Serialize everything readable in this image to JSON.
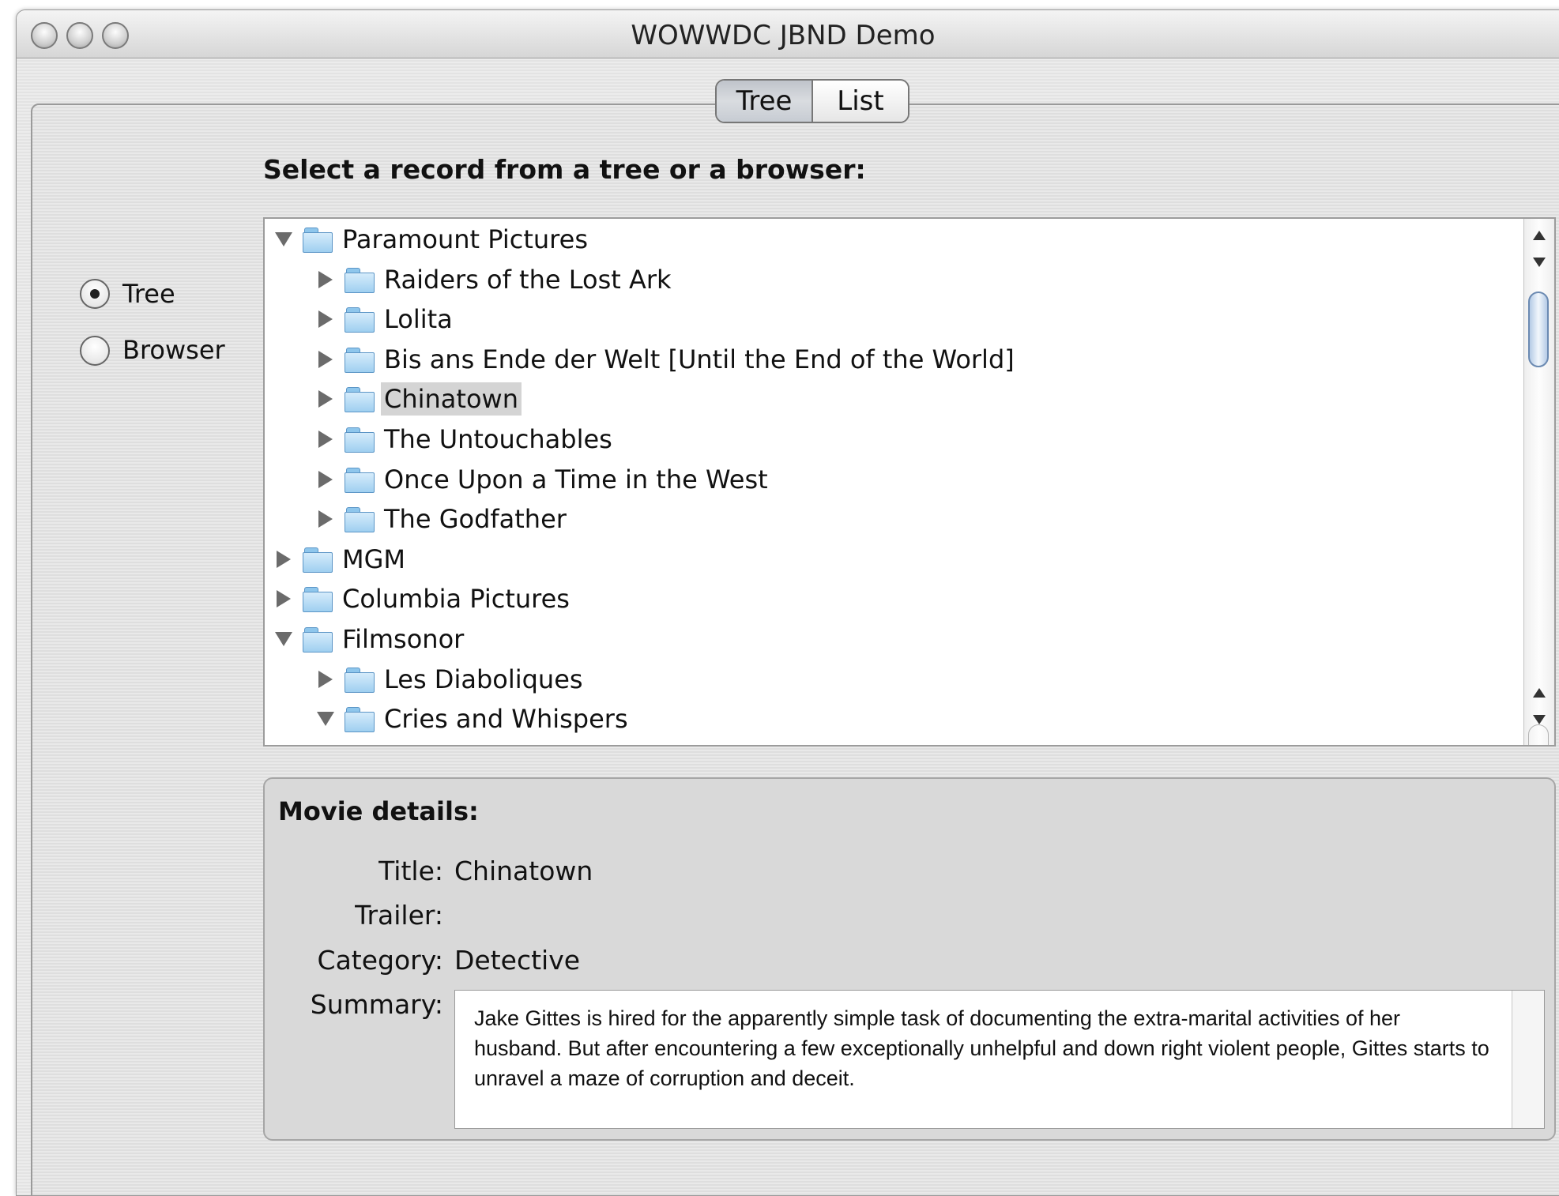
{
  "window": {
    "title": "WOWWDC JBND Demo"
  },
  "tabs": [
    {
      "label": "Tree",
      "selected": true
    },
    {
      "label": "List",
      "selected": false
    }
  ],
  "view_mode": {
    "options": [
      {
        "label": "Tree",
        "selected": true
      },
      {
        "label": "Browser",
        "selected": false
      }
    ]
  },
  "selector": {
    "heading": "Select a record from a tree or a browser:"
  },
  "tree": {
    "rows": [
      {
        "label": "Paramount Pictures",
        "level": 0,
        "expanded": true,
        "selected": false,
        "icon": "folder-icon"
      },
      {
        "label": "Raiders of the Lost Ark",
        "level": 1,
        "expanded": false,
        "selected": false,
        "icon": "folder-icon"
      },
      {
        "label": "Lolita",
        "level": 1,
        "expanded": false,
        "selected": false,
        "icon": "folder-icon"
      },
      {
        "label": "Bis ans Ende der Welt [Until the End of the World]",
        "level": 1,
        "expanded": false,
        "selected": false,
        "icon": "folder-icon"
      },
      {
        "label": "Chinatown",
        "level": 1,
        "expanded": false,
        "selected": true,
        "icon": "folder-icon"
      },
      {
        "label": "The Untouchables",
        "level": 1,
        "expanded": false,
        "selected": false,
        "icon": "folder-icon"
      },
      {
        "label": "Once Upon a Time in the West",
        "level": 1,
        "expanded": false,
        "selected": false,
        "icon": "folder-icon"
      },
      {
        "label": "The Godfather",
        "level": 1,
        "expanded": false,
        "selected": false,
        "icon": "folder-icon"
      },
      {
        "label": "MGM",
        "level": 0,
        "expanded": false,
        "selected": false,
        "icon": "folder-icon"
      },
      {
        "label": "Columbia Pictures",
        "level": 0,
        "expanded": false,
        "selected": false,
        "icon": "folder-icon"
      },
      {
        "label": "Filmsonor",
        "level": 0,
        "expanded": true,
        "selected": false,
        "icon": "folder-icon"
      },
      {
        "label": "Les Diaboliques",
        "level": 1,
        "expanded": false,
        "selected": false,
        "icon": "folder-icon"
      },
      {
        "label": "Cries and Whispers",
        "level": 1,
        "expanded": true,
        "selected": false,
        "icon": "folder-icon"
      }
    ]
  },
  "details": {
    "heading": "Movie details:",
    "title_label": "Title:",
    "title_value": "Chinatown",
    "trailer_label": "Trailer:",
    "trailer_value": "",
    "category_label": "Category:",
    "category_value": "Detective",
    "summary_label": "Summary:",
    "summary_value": "Jake Gittes is hired for the apparently simple task of documenting the extra-marital activities of her husband. But after encountering a few exceptionally unhelpful and down right violent people, Gittes starts to unravel a maze of corruption and deceit."
  }
}
